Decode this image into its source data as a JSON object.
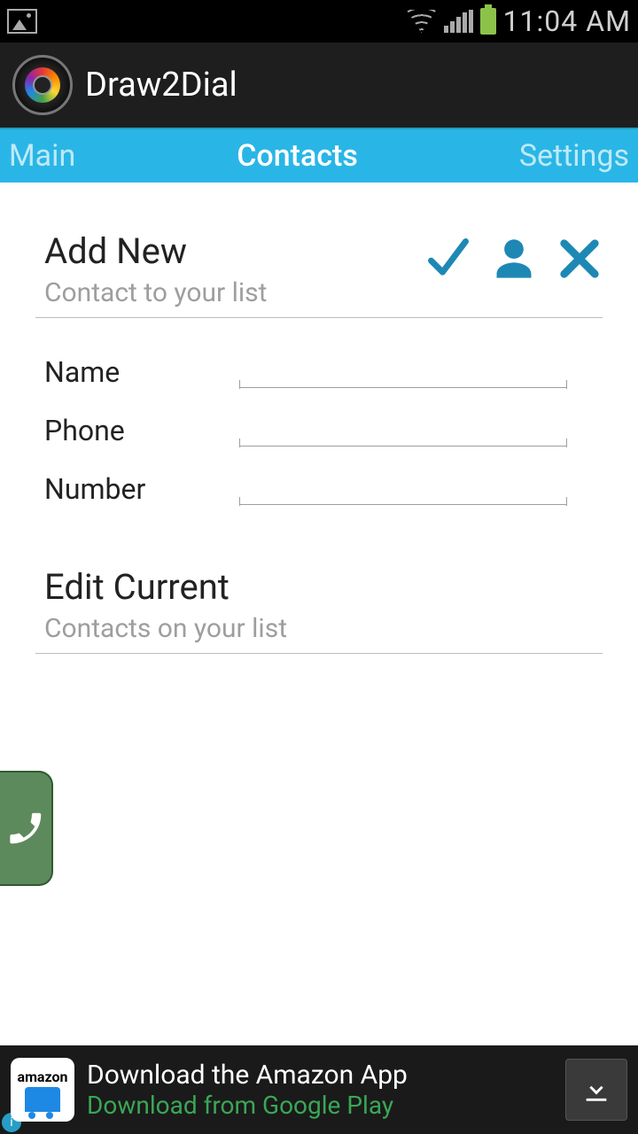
{
  "status": {
    "time": "11:04 AM"
  },
  "app": {
    "title": "Draw2Dial"
  },
  "tabs": {
    "main": "Main",
    "contacts": "Contacts",
    "settings": "Settings"
  },
  "addSection": {
    "title": "Add New",
    "subtitle": "Contact to your list"
  },
  "fields": {
    "name": {
      "label": "Name",
      "value": ""
    },
    "phone": {
      "label": "Phone",
      "value": ""
    },
    "number": {
      "label": "Number",
      "value": ""
    }
  },
  "editSection": {
    "title": "Edit Current",
    "subtitle": "Contacts on your list"
  },
  "ad": {
    "brand": "amazon",
    "title": "Download the Amazon App",
    "subtitle": "Download from Google Play"
  }
}
